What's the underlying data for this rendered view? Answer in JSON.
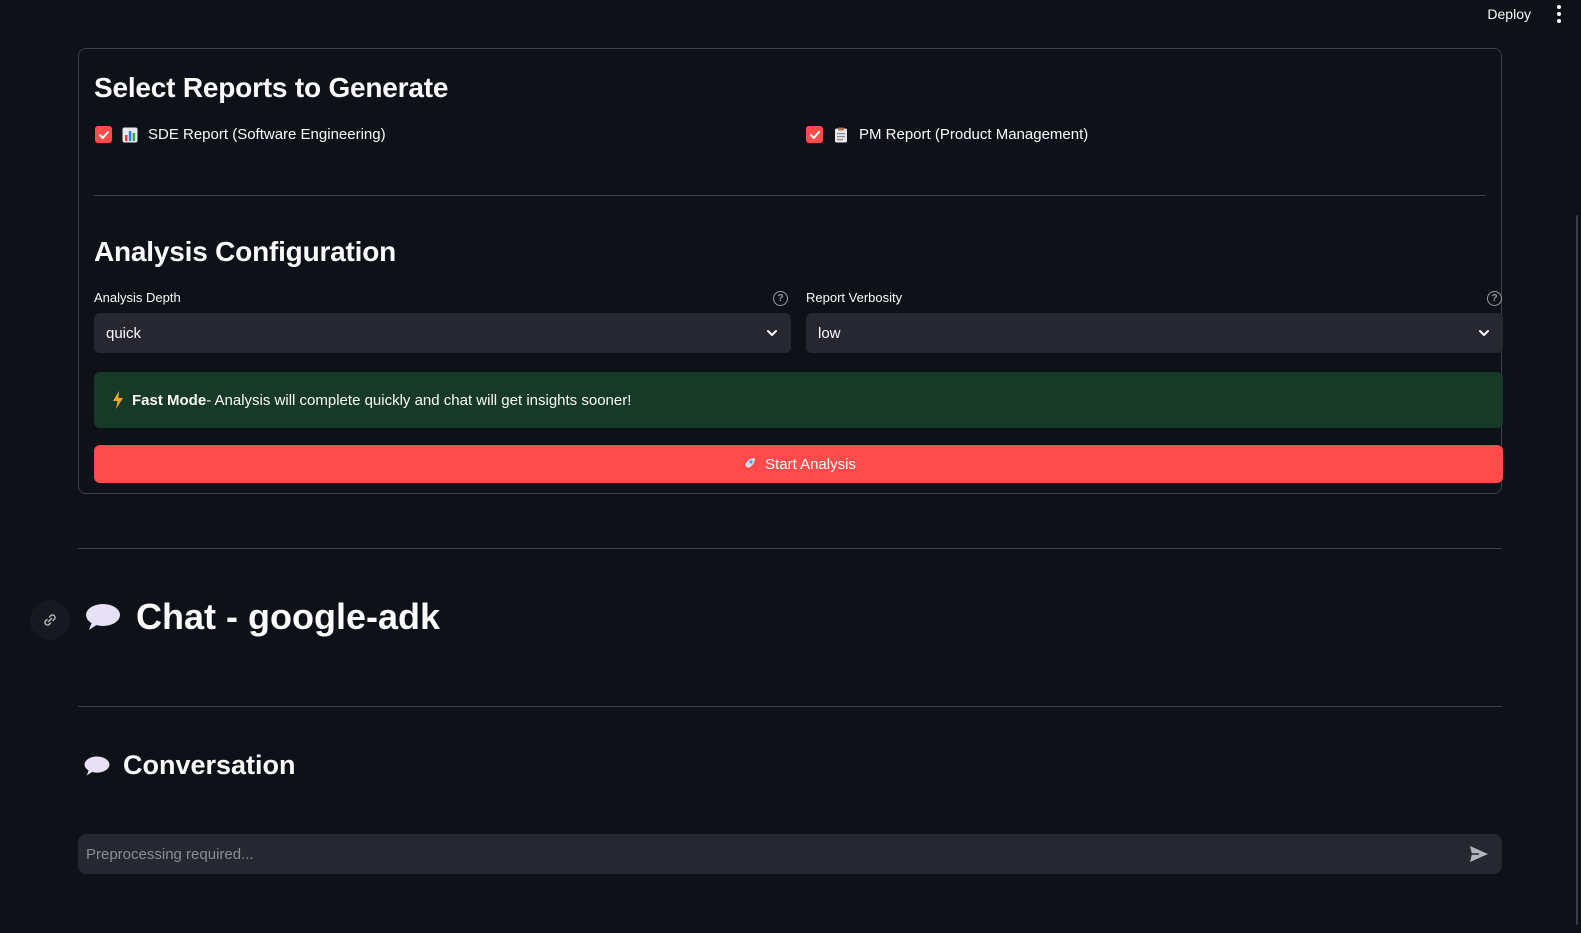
{
  "topbar": {
    "deploy_label": "Deploy"
  },
  "reports": {
    "title": "Select Reports to Generate",
    "sde": {
      "label": "SDE Report (Software Engineering)",
      "checked": true,
      "icon": "bar-chart-icon"
    },
    "pm": {
      "label": "PM Report (Product Management)",
      "checked": true,
      "icon": "clipboard-icon"
    }
  },
  "config": {
    "title": "Analysis Configuration",
    "depth": {
      "label": "Analysis Depth",
      "value": "quick"
    },
    "verbosity": {
      "label": "Report Verbosity",
      "value": "low"
    },
    "alert": {
      "bold": "Fast Mode",
      "text": " - Analysis will complete quickly and chat will get insights sooner!"
    },
    "start_label": "Start Analysis"
  },
  "chat": {
    "title": "Chat - google-adk",
    "conversation_title": "Conversation",
    "input_placeholder": "Preprocessing required..."
  },
  "colors": {
    "background": "#0e1117",
    "accent": "#ff4b4b",
    "success_bg": "#173928",
    "input_bg": "#262730"
  }
}
